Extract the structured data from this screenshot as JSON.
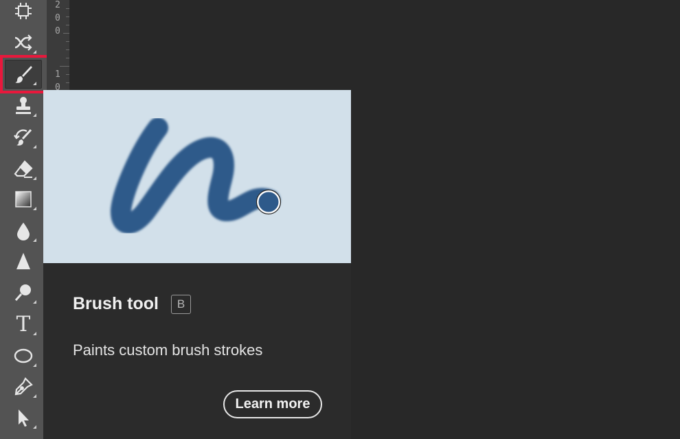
{
  "toolbar": {
    "tools": [
      {
        "name": "artboard-tool",
        "icon": "artboard-icon"
      },
      {
        "name": "content-aware-move-tool",
        "icon": "content-aware-move-icon"
      },
      {
        "name": "brush-tool",
        "icon": "brush-icon",
        "active": true
      },
      {
        "name": "clone-stamp-tool",
        "icon": "stamp-icon"
      },
      {
        "name": "history-brush-tool",
        "icon": "history-brush-icon"
      },
      {
        "name": "eraser-tool",
        "icon": "eraser-icon"
      },
      {
        "name": "gradient-tool",
        "icon": "gradient-icon"
      },
      {
        "name": "blur-tool",
        "icon": "drop-icon"
      },
      {
        "name": "sharpen-tool",
        "icon": "sharpen-icon"
      },
      {
        "name": "dodge-tool",
        "icon": "dodge-icon"
      },
      {
        "name": "type-tool",
        "icon": "type-icon"
      },
      {
        "name": "ellipse-tool",
        "icon": "ellipse-icon"
      },
      {
        "name": "pen-tool",
        "icon": "pen-icon"
      },
      {
        "name": "selection-tool",
        "icon": "arrow-cursor-icon"
      }
    ],
    "type_glyph": "T"
  },
  "ruler": {
    "label_top": "200",
    "label_bottom": "10"
  },
  "tooltip": {
    "title": "Brush tool",
    "shortcut": "B",
    "description": "Paints custom brush strokes",
    "learn_more": "Learn more",
    "stroke_color": "#2e5a8a",
    "preview_bg": "#d2e0ea"
  }
}
